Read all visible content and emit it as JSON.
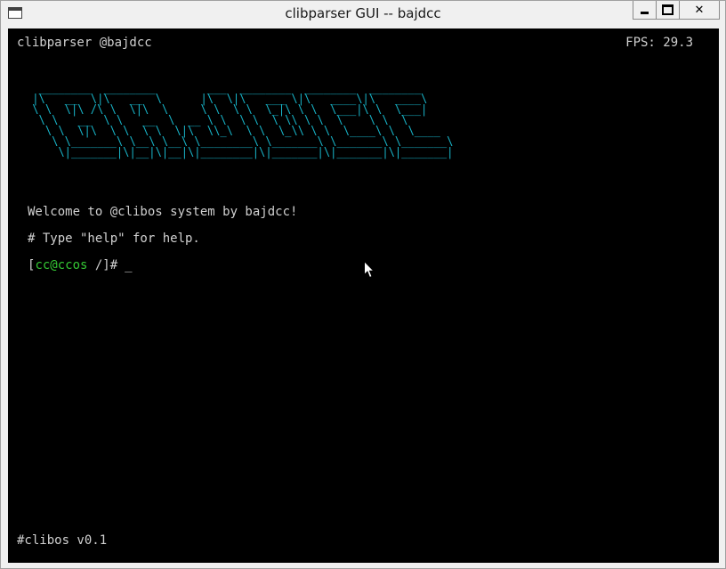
{
  "window": {
    "title": "clibparser GUI -- bajdcc",
    "buttons": [
      "minimize",
      "maximize",
      "close"
    ],
    "close_label": "✕"
  },
  "terminal": {
    "header": "clibparser @bajdcc",
    "fps": "FPS: 29.3",
    "banner_lines": [
      "  ________  ________        ___  ________  ________  ________",
      " |\\   __  \\|\\   __  \\      |\\  \\|\\   ___ \\|\\   ____\\|\\   ____\\",
      " \\ \\  \\|\\ /\\ \\  \\|\\  \\     \\ \\  \\ \\  \\_|\\ \\ \\  \\___|\\ \\  \\___|",
      "  \\ \\   __  \\ \\   __  \\  __ \\ \\  \\ \\  \\ \\\\ \\ \\  \\    \\ \\  \\",
      "   \\ \\  \\|\\  \\ \\  \\ \\  \\|\\  \\\\_\\  \\ \\  \\_\\\\ \\ \\  \\____\\ \\  \\____",
      "    \\ \\_______\\ \\__\\ \\__\\ \\________\\ \\_______\\ \\_______\\ \\_______\\",
      "     \\|_______|\\|__|\\|__|\\|________|\\|_______|\\|_______|\\|_______|"
    ],
    "welcome": "Welcome to @clibos system by bajdcc!",
    "help_line": "# Type \"help\" for help.",
    "prompt": {
      "open": "[",
      "user": "cc@ccos",
      "path_tail": " /]#",
      "cursor": "_"
    },
    "footer": "#clibos v0.1"
  },
  "colors": {
    "background": "#000000",
    "text": "#d0d0d0",
    "banner": "#18b4c8",
    "prompt_user": "#34c734"
  },
  "icons": [
    "app-window-icon",
    "mouse-pointer-icon"
  ]
}
